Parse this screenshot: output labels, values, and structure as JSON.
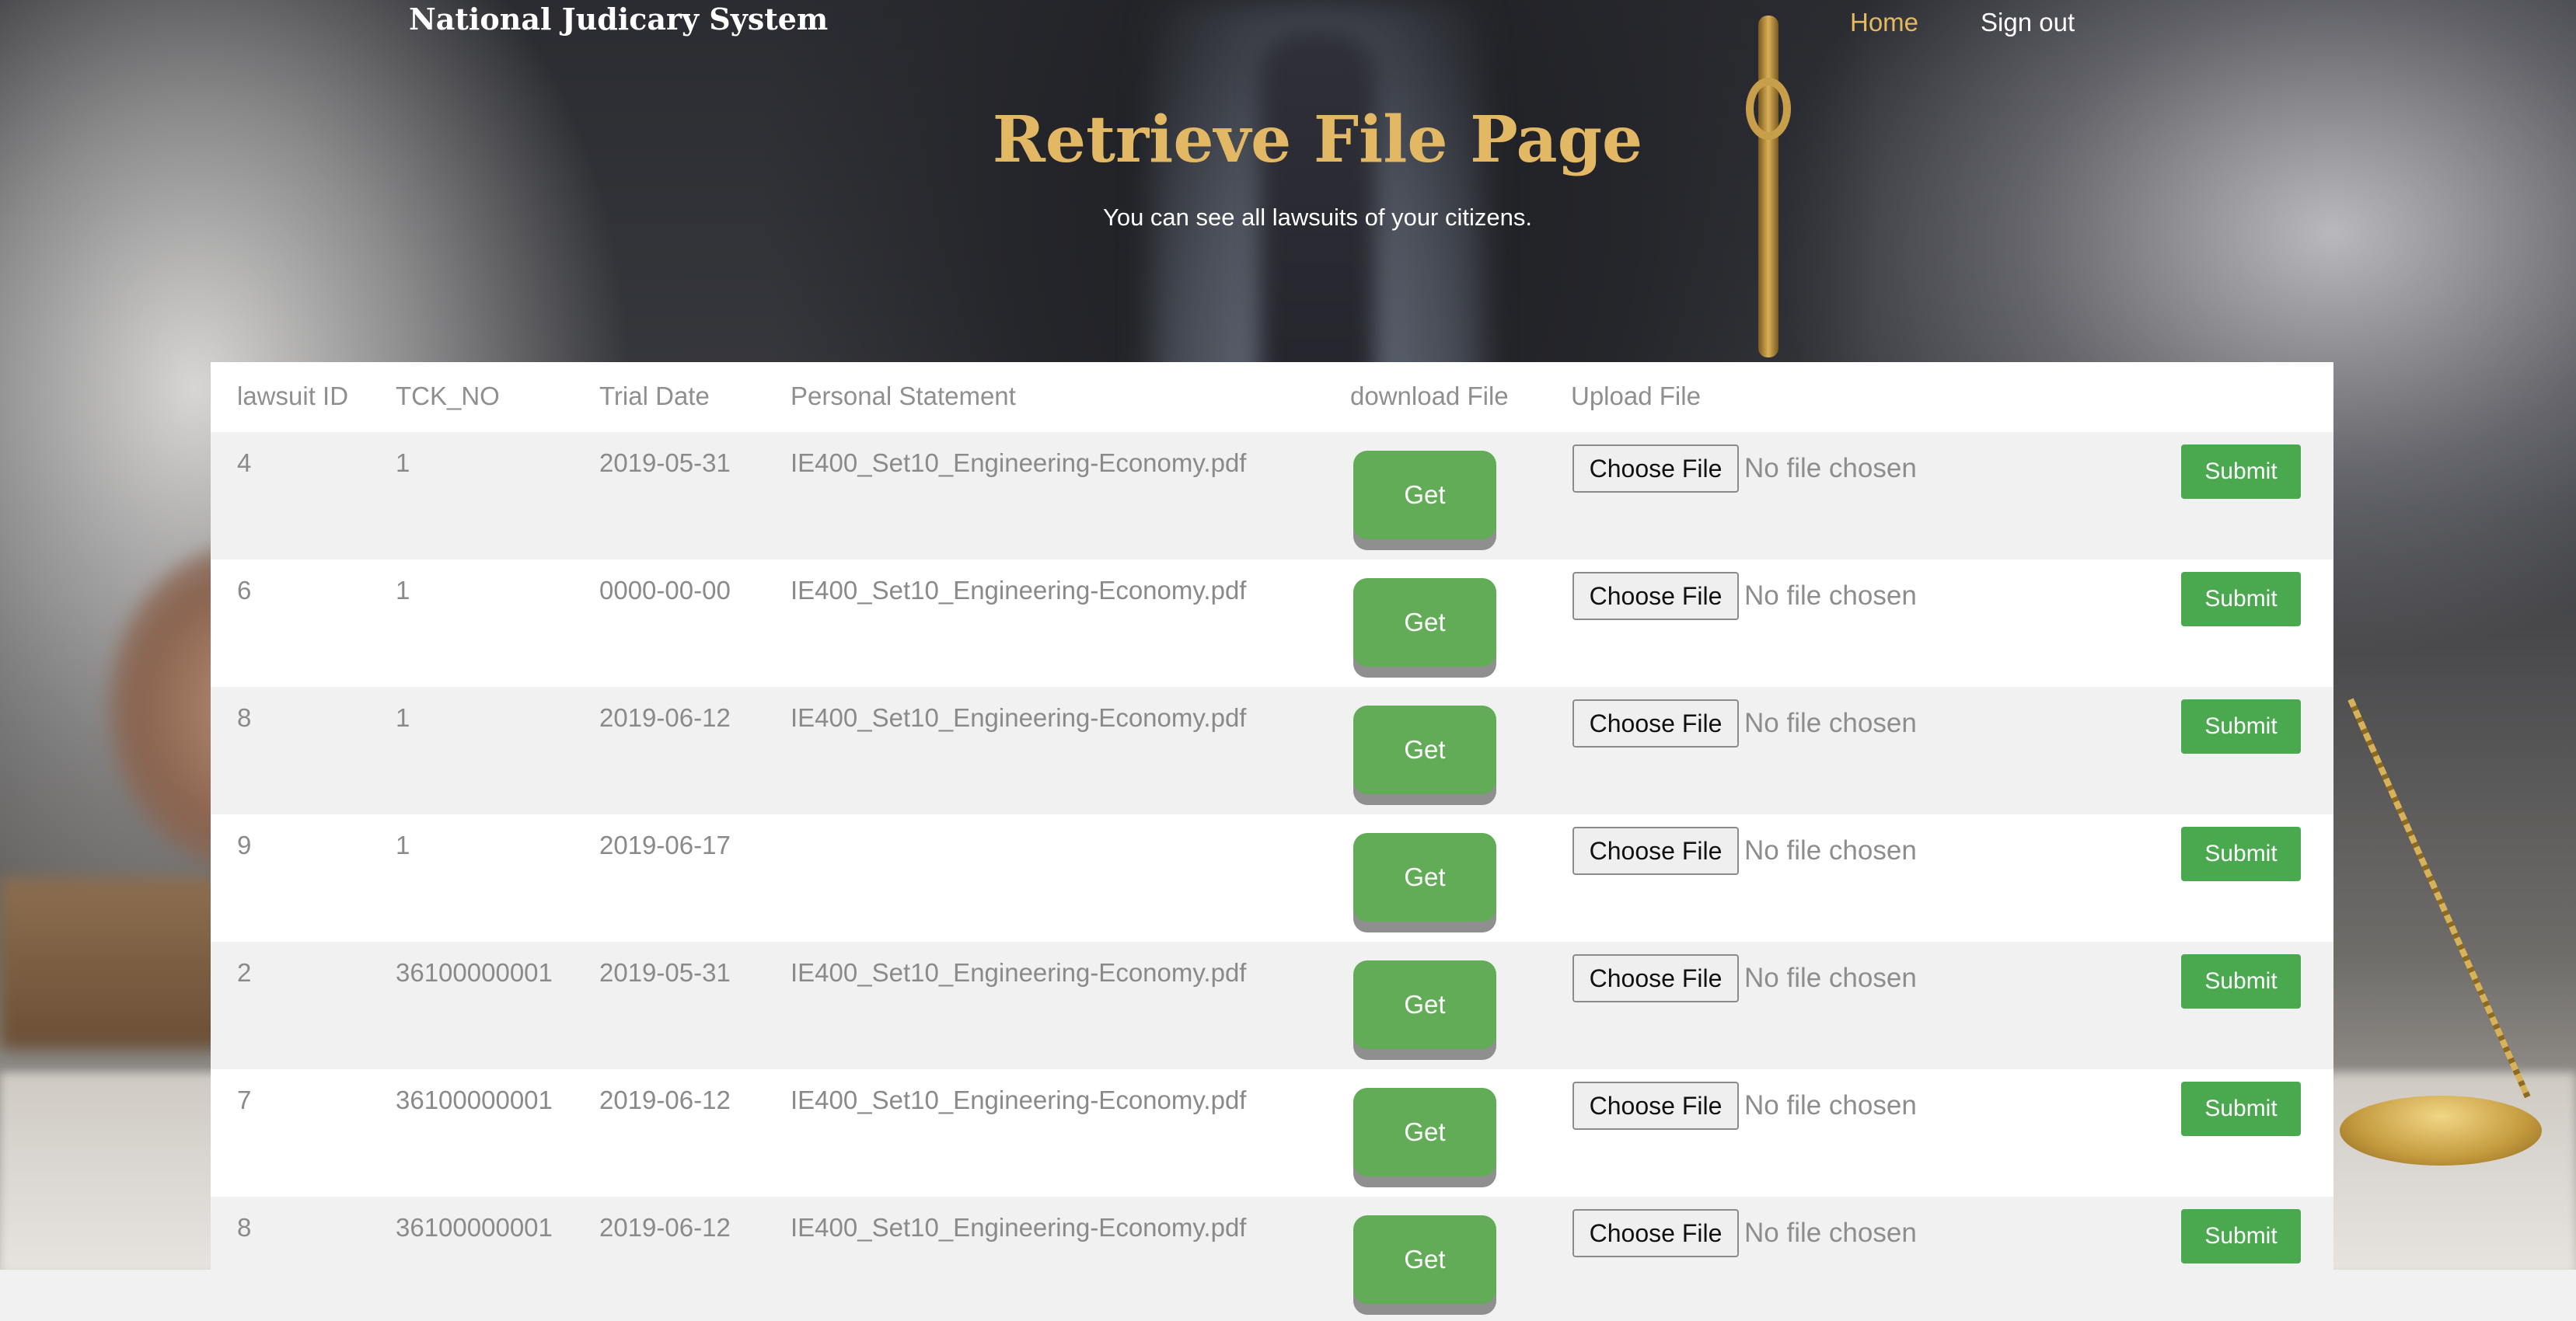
{
  "header": {
    "brand": "National Judicary System",
    "nav": [
      {
        "label": "Home",
        "active": true
      },
      {
        "label": "Sign out",
        "active": false
      }
    ]
  },
  "hero": {
    "title": "Retrieve File Page",
    "subtitle": "You can see all lawsuits of your citizens."
  },
  "table": {
    "headers": [
      "lawsuit ID",
      "TCK_NO",
      "Trial Date",
      "Personal Statement",
      "download File",
      "Upload File"
    ],
    "rows": [
      {
        "id": "4",
        "tck": "1",
        "date": "2019-05-31",
        "statement": "IE400_Set10_Engineering-Economy.pdf"
      },
      {
        "id": "6",
        "tck": "1",
        "date": "0000-00-00",
        "statement": "IE400_Set10_Engineering-Economy.pdf"
      },
      {
        "id": "8",
        "tck": "1",
        "date": "2019-06-12",
        "statement": "IE400_Set10_Engineering-Economy.pdf"
      },
      {
        "id": "9",
        "tck": "1",
        "date": "2019-06-17",
        "statement": ""
      },
      {
        "id": "2",
        "tck": "36100000001",
        "date": "2019-05-31",
        "statement": "IE400_Set10_Engineering-Economy.pdf"
      },
      {
        "id": "7",
        "tck": "36100000001",
        "date": "2019-06-12",
        "statement": "IE400_Set10_Engineering-Economy.pdf"
      },
      {
        "id": "8",
        "tck": "36100000001",
        "date": "2019-06-12",
        "statement": "IE400_Set10_Engineering-Economy.pdf"
      }
    ],
    "get_label": "Get",
    "choose_label": "Choose File",
    "no_file_label": "No file chosen",
    "submit_label": "Submit"
  },
  "colors": {
    "accent_gold": "#e3b864",
    "button_green": "#62ac57",
    "submit_green": "#4aa84f",
    "row_alt": "#f1f1f1"
  }
}
